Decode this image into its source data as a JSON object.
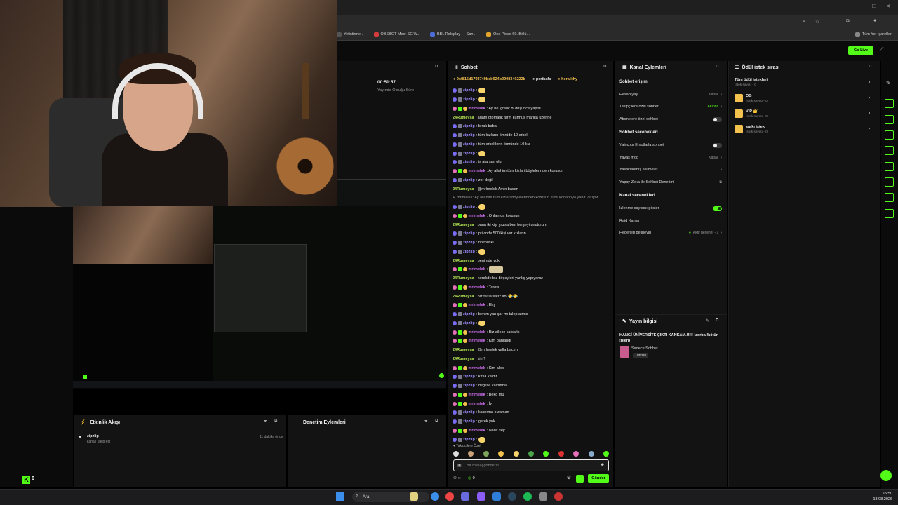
{
  "browser": {
    "bookmarks": [
      {
        "label": "Yetiştirme...",
        "color": "#555555"
      },
      {
        "label": "OBSBOT Meet SE W...",
        "color": "#d63c3c"
      },
      {
        "label": "BBL Roleplay — San...",
        "color": "#4a6cd4"
      },
      {
        "label": "One Piece 69. Bölü...",
        "color": "#e2a42b"
      }
    ],
    "other_bookmarks": "Tüm Yer İşaretleri",
    "live_badge": "Go Live"
  },
  "stats": {
    "time": "00:51:57",
    "label": "Yayında Olduğu Süre"
  },
  "chat": {
    "title": "Sohbet",
    "pinned": [
      {
        "text": "9cf815d1793749bcb624b9908340222b",
        "color": "#f2c14e"
      },
      {
        "text": "pertkafa",
        "color": "#e0e0e0"
      },
      {
        "text": "heralithy",
        "color": "#f2c14e"
      }
    ],
    "messages": [
      {
        "user": "zipzlip",
        "color": "#9b8cff",
        "badges": [
          "b-purple",
          "b-grey"
        ],
        "text": ":",
        "emote": true
      },
      {
        "user": "zipzlip",
        "color": "#9b8cff",
        "badges": [
          "b-purple",
          "b-grey"
        ],
        "text": ":",
        "emote": true
      },
      {
        "user": "mrlmelek",
        "color": "#d06ff0",
        "badges": [
          "b-pink",
          "b-green",
          "b-yellow"
        ],
        "text": ": Ay ne igrenc bi düşünce yapisi"
      },
      {
        "user": "24Rumeysa",
        "color": "#b5e853",
        "badges": [],
        "text": ": adam otomatik farm kurmuş manita üzerine"
      },
      {
        "user": "zipzlip",
        "color": "#9b8cff",
        "badges": [
          "b-purple",
          "b-grey"
        ],
        "text": ": bırak baba"
      },
      {
        "user": "zipzlip",
        "color": "#9b8cff",
        "badges": [
          "b-purple",
          "b-grey"
        ],
        "text": ": tüm kızların ömrüde 10 erkek"
      },
      {
        "user": "zipzlip",
        "color": "#9b8cff",
        "badges": [
          "b-purple",
          "b-grey"
        ],
        "text": ": tüm erkeklerin ömründe 10 kız"
      },
      {
        "user": "zipzlip",
        "color": "#9b8cff",
        "badges": [
          "b-purple",
          "b-grey"
        ],
        "text": ":",
        "emote": true
      },
      {
        "user": "zipzlip",
        "color": "#9b8cff",
        "badges": [
          "b-purple",
          "b-grey"
        ],
        "text": ": iş atarsan olur"
      },
      {
        "user": "mrlmelek",
        "color": "#d06ff0",
        "badges": [
          "b-pink",
          "b-green",
          "b-yellow"
        ],
        "text": ": Ay allahim tüm kizlari böylelerinden korusun"
      },
      {
        "user": "zipzlip",
        "color": "#9b8cff",
        "badges": [
          "b-purple",
          "b-grey"
        ],
        "text": ": zor değil"
      },
      {
        "user": "24Rumeysa",
        "color": "#b5e853",
        "badges": [],
        "text": ": @mrlmelek Amin bacım"
      },
      {
        "user": "",
        "color": "#9a9a9a",
        "badges": [],
        "text": "↳ mrlmelek: Ay allahim tüm kizlari böylelerinden korusun kimli kodarcıya yanıt veriyor",
        "muted": true
      },
      {
        "user": "zipzlip",
        "color": "#9b8cff",
        "badges": [
          "b-purple",
          "b-grey"
        ],
        "text": ":",
        "emote": true
      },
      {
        "user": "mrlmelek",
        "color": "#d06ff0",
        "badges": [
          "b-pink",
          "b-green",
          "b-yellow"
        ],
        "text": ": Onları da korusun"
      },
      {
        "user": "24Rumeysa",
        "color": "#b5e853",
        "badges": [],
        "text": ": bana iki kişi yazsa ben herşeyi unuturum"
      },
      {
        "user": "zipzlip",
        "color": "#9b8cff",
        "badges": [
          "b-purple",
          "b-grey"
        ],
        "text": ": privinde 500 kişi var kızların"
      },
      {
        "user": "zipzlip",
        "color": "#9b8cff",
        "badges": [
          "b-purple",
          "b-grey"
        ],
        "text": ": nolmuski"
      },
      {
        "user": "zipzlip",
        "color": "#9b8cff",
        "badges": [
          "b-purple",
          "b-grey"
        ],
        "text": ":",
        "emote": true
      },
      {
        "user": "24Rumeysa",
        "color": "#b5e853",
        "badges": [],
        "text": ": benimde yok"
      },
      {
        "user": "mrlmelek",
        "color": "#d06ff0",
        "badges": [
          "b-pink",
          "b-green",
          "b-yellow"
        ],
        "text": ":",
        "emote_wide": true
      },
      {
        "user": "24Rumeysa",
        "color": "#b5e853",
        "badges": [],
        "text": ": herakde biz birşeyleri yanlış yapıyoruz"
      },
      {
        "user": "mrlmelek",
        "color": "#d06ff0",
        "badges": [
          "b-pink",
          "b-green",
          "b-yellow"
        ],
        "text": ": Tarosu"
      },
      {
        "user": "24Rumeysa",
        "color": "#b5e853",
        "badges": [],
        "text": ": biz fazla safız abi 😂😂"
      },
      {
        "user": "mrlmelek",
        "color": "#d06ff0",
        "badges": [
          "b-pink",
          "b-green",
          "b-yellow"
        ],
        "text": ": Ehy"
      },
      {
        "user": "zipzlip",
        "color": "#9b8cff",
        "badges": [
          "b-purple",
          "b-grey"
        ],
        "text": ": benim yan çar mı talep atmıs"
      },
      {
        "user": "zipzlip",
        "color": "#9b8cff",
        "badges": [
          "b-purple",
          "b-grey"
        ],
        "text": ":",
        "emote": true
      },
      {
        "user": "mrlmelek",
        "color": "#d06ff0",
        "badges": [
          "b-pink",
          "b-green",
          "b-yellow"
        ],
        "text": ": Biz ailece safsafik"
      },
      {
        "user": "mrlmelek",
        "color": "#d06ff0",
        "badges": [
          "b-pink",
          "b-green",
          "b-yellow"
        ],
        "text": ": Kim banlandi"
      },
      {
        "user": "24Rumeysa",
        "color": "#b5e853",
        "badges": [],
        "text": ": @mrlmelek valla bacım"
      },
      {
        "user": "24Rumeysa",
        "color": "#b5e853",
        "badges": [],
        "text": ": kim?"
      },
      {
        "user": "mrlmelek",
        "color": "#d06ff0",
        "badges": [
          "b-pink",
          "b-green",
          "b-yellow"
        ],
        "text": ": Kim aloo"
      },
      {
        "user": "zipzlip",
        "color": "#9b8cff",
        "badges": [
          "b-purple",
          "b-grey"
        ],
        "text": ": kıtsa kaldır"
      },
      {
        "user": "zipzlip",
        "color": "#9b8cff",
        "badges": [
          "b-purple",
          "b-grey"
        ],
        "text": ": değilse kaldırma"
      },
      {
        "user": "mrlmelek",
        "color": "#d06ff0",
        "badges": [
          "b-pink",
          "b-green",
          "b-yellow"
        ],
        "text": ": Beko mu"
      },
      {
        "user": "mrlmelek",
        "color": "#d06ff0",
        "badges": [
          "b-pink",
          "b-green",
          "b-yellow"
        ],
        "text": ": İy"
      },
      {
        "user": "zipzlip",
        "color": "#9b8cff",
        "badges": [
          "b-purple",
          "b-grey"
        ],
        "text": ": kaldırma o zaman"
      },
      {
        "user": "zipzlip",
        "color": "#9b8cff",
        "badges": [
          "b-purple",
          "b-grey"
        ],
        "text": ": gerek yok"
      },
      {
        "user": "mrlmelek",
        "color": "#d06ff0",
        "badges": [
          "b-pink",
          "b-green",
          "b-yellow"
        ],
        "text": ": Nalet sey"
      },
      {
        "user": "zipzlip",
        "color": "#9b8cff",
        "badges": [
          "b-purple",
          "b-grey"
        ],
        "text": ":",
        "emote": true
      }
    ],
    "followers_only": "Takipçilere Özel",
    "input_placeholder": "Bir mesaj gönderin",
    "viewer_count": "∞",
    "points": "0",
    "send_label": "Gönder"
  },
  "actions": {
    "title": "Kanal Eylemleri",
    "chat_access_title": "Sohbet erişimi",
    "account_age": {
      "label": "Hesap yaşı",
      "value": "Kapalı"
    },
    "followers_chat": {
      "label": "Takipçilere özel sohbet",
      "value": "Anında"
    },
    "subscribers_chat": {
      "label": "Abonelere özel sohbet"
    },
    "chat_options_title": "Sohbet seçenekleri",
    "emotes_only": {
      "label": "Yalnızca Emotlarla sohbet"
    },
    "slow_mode": {
      "label": "Yavaş mod",
      "value": "Kapalı"
    },
    "banned_words": {
      "label": "Yasaklanmış kelimeler"
    },
    "ai_moderation": {
      "label": "Yapay Zeka ile Sohbet Denetimi"
    },
    "channel_options_title": "Kanal seçenekleri",
    "show_viewers": {
      "label": "İzlenme sayısını göster"
    },
    "raid": {
      "label": "Raid Kanalı"
    },
    "targets": {
      "label": "Hedefleri belirleyin",
      "value": "Aktif hedefler - 1"
    }
  },
  "info": {
    "title": "Yayın bilgisi",
    "stream_title": "HANGİ ÜNİVERSİTE ÇIKTI KANKAM.!!!!! !zorba !kötür !blerp",
    "category": "Sadece Sohbet",
    "language": "Turkish"
  },
  "rewards": {
    "title": "Ödül istek sırası",
    "all_label": "Tüm ödül istekleri",
    "all_count": "İstek sayısı - 0",
    "items": [
      {
        "name": "OG",
        "count": "İstek sayısı - 0"
      },
      {
        "name": "VIP 👑",
        "count": "İstek sayısı - 0"
      },
      {
        "name": "şarkı istek",
        "count": "İstek sayısı - 0"
      }
    ]
  },
  "activity": {
    "title": "Etkinlik Akışı",
    "user": "zipzlip",
    "desc": "kanalı takip etti",
    "time": "11 dakika önce"
  },
  "moderation": {
    "title": "Denetim Eylemleri"
  },
  "sidebar": {
    "kick_count": "6"
  },
  "taskbar": {
    "search": "Ara",
    "time": "16:50",
    "date": "18.08.2026"
  }
}
